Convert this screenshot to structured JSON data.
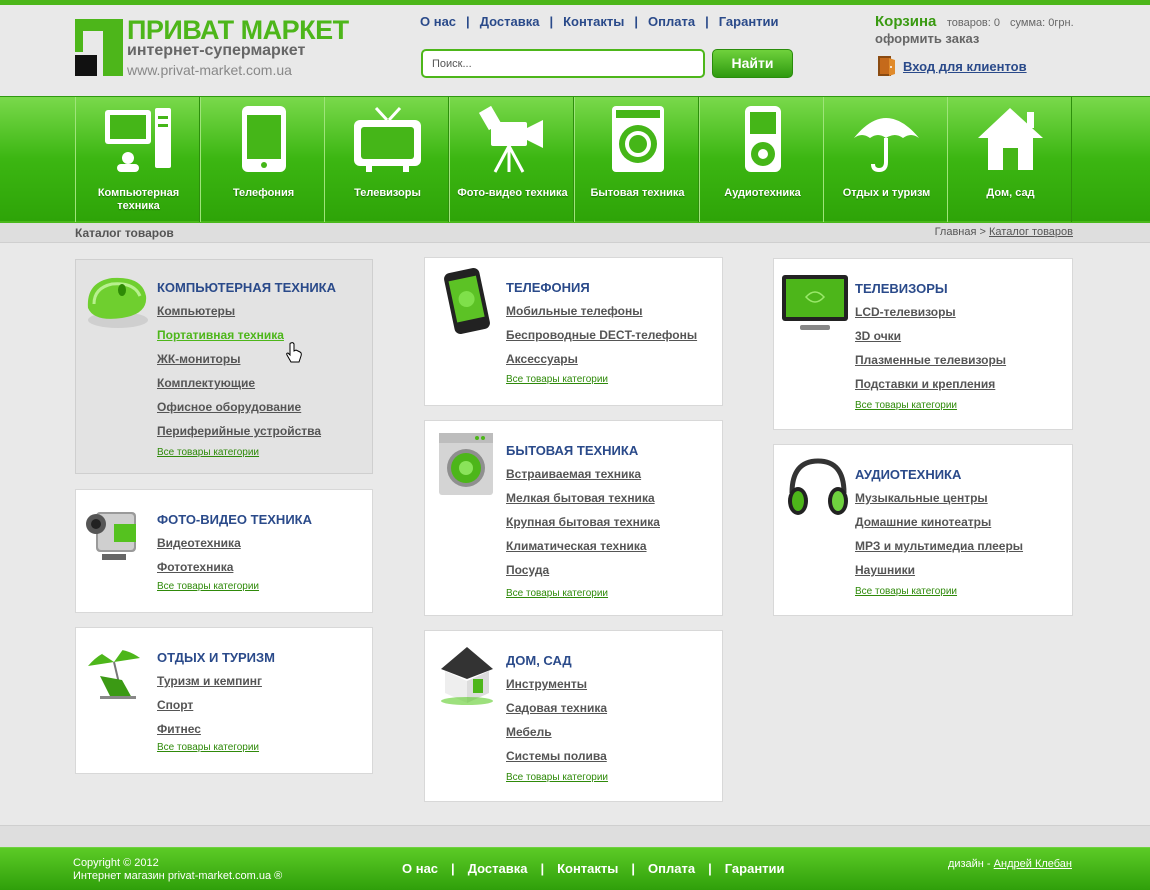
{
  "logo": {
    "title": "ПРИВАТ МАРКЕТ",
    "subtitle": "интернет-супермаркет",
    "url": "www.privat-market.com.ua"
  },
  "topnav": [
    "О нас",
    "Доставка",
    "Контакты",
    "Оплата",
    "Гарантии"
  ],
  "search": {
    "placeholder": "Поиск...",
    "button": "Найти"
  },
  "cart": {
    "title": "Корзина",
    "items": "товаров: 0",
    "sum": "сумма: 0грн.",
    "order": "оформить заказ"
  },
  "login": {
    "label": "Вход для клиентов",
    "icon": "door-icon"
  },
  "categories": [
    {
      "label": "Компьютерная техника",
      "icon": "computer-icon"
    },
    {
      "label": "Телефония",
      "icon": "phone-icon"
    },
    {
      "label": "Телевизоры",
      "icon": "tv-icon"
    },
    {
      "label": "Фото-видео техника",
      "icon": "camera-icon"
    },
    {
      "label": "Бытовая техника",
      "icon": "washer-icon"
    },
    {
      "label": "Аудиотехника",
      "icon": "audio-player-icon"
    },
    {
      "label": "Отдых и туризм",
      "icon": "umbrella-icon"
    },
    {
      "label": "Дом, сад",
      "icon": "house-icon"
    }
  ],
  "catalog": {
    "title": "Каталог товаров",
    "breadcrumb_home": "Главная",
    "breadcrumb_sep": ">",
    "breadcrumb_current": "Каталог товаров"
  },
  "all_link": "Все товары категории",
  "boxes": {
    "computers": {
      "title": "КОМПЬЮТЕРНАЯ ТЕХНИКА",
      "links": [
        "Компьютеры",
        "Портативная техника",
        "ЖК-мониторы",
        "Комплектующие",
        "Офисное оборудование",
        "Периферийные устройства"
      ]
    },
    "photo": {
      "title": "ФОТО-ВИДЕО ТЕХНИКА",
      "links": [
        "Видеотехника",
        "Фототехника"
      ]
    },
    "leisure": {
      "title": "ОТДЫХ И ТУРИЗМ",
      "links": [
        "Туризм и кемпинг",
        "Спорт",
        "Фитнес"
      ]
    },
    "phones": {
      "title": "ТЕЛЕФОНИЯ",
      "links": [
        "Мобильные телефоны",
        "Беспроводные DECT-телефоны",
        "Аксессуары"
      ]
    },
    "appliances": {
      "title": "БЫТОВАЯ ТЕХНИКА",
      "links": [
        "Встраиваемая техника",
        "Мелкая бытовая техника",
        "Крупная бытовая техника",
        "Климатическая техника",
        "Посуда"
      ]
    },
    "home": {
      "title": "ДОМ, САД",
      "links": [
        "Инструменты",
        "Садовая техника",
        "Мебель",
        "Системы полива"
      ]
    },
    "tv": {
      "title": "ТЕЛЕВИЗОРЫ",
      "links": [
        "LCD-телевизоры",
        "3D очки",
        "Плазменные телевизоры",
        "Подставки и крепления"
      ]
    },
    "audio": {
      "title": "АУДИОТЕХНИКА",
      "links": [
        "Музыкальные центры",
        "Домашние кинотеатры",
        "МРЗ и мультимедиа плееры",
        "Наушники"
      ]
    }
  },
  "footer": {
    "copyright": "Copyright © 2012",
    "shop": "Интернет магазин privat-market.com.ua ®",
    "nav": [
      "О нас",
      "Доставка",
      "Контакты",
      "Оплата",
      "Гарантии"
    ],
    "design_label": "дизайн -",
    "design_author": "Андрей Клебан"
  },
  "colors": {
    "brand_green": "#4db61a",
    "link_blue": "#2a4a8a"
  }
}
